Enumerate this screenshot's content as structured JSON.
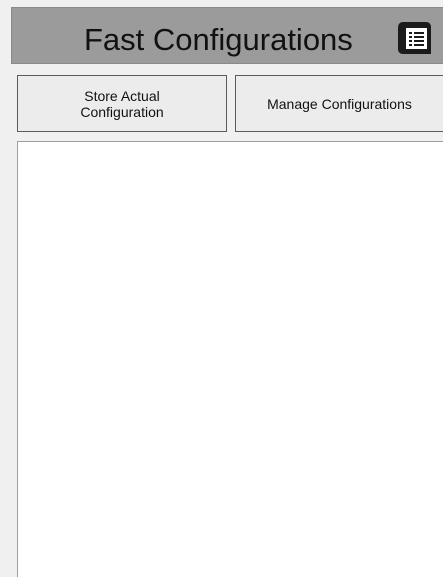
{
  "header": {
    "title": "Fast Configurations",
    "icon": "configuration-list-icon"
  },
  "toolbar": {
    "store_label": "Store Actual Configuration",
    "manage_label": "Manage Configurations"
  },
  "configurations": {
    "items": []
  },
  "colors": {
    "header_bg": "#9b9b9b",
    "window_bg": "#f0f0f0",
    "button_bg": "#ececec",
    "panel_bg": "#ffffff"
  }
}
